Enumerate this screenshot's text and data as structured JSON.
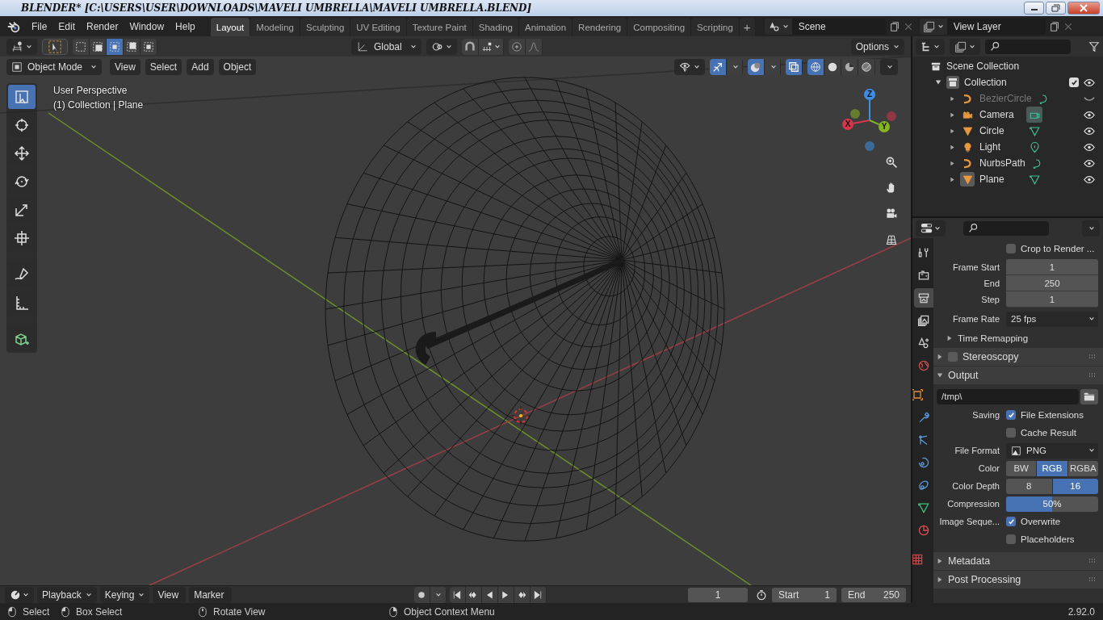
{
  "window": {
    "title": "BLENDER* [C:\\USERS\\USER\\DOWNLOADS\\MAVELI UMBRELLA\\MAVELI UMBRELLA.BLEND]"
  },
  "menu": [
    "File",
    "Edit",
    "Render",
    "Window",
    "Help"
  ],
  "workspaces": [
    {
      "label": "Layout",
      "selected": true
    },
    {
      "label": "Modeling",
      "selected": false
    },
    {
      "label": "Sculpting",
      "selected": false
    },
    {
      "label": "UV Editing",
      "selected": false
    },
    {
      "label": "Texture Paint",
      "selected": false
    },
    {
      "label": "Shading",
      "selected": false
    },
    {
      "label": "Animation",
      "selected": false
    },
    {
      "label": "Rendering",
      "selected": false
    },
    {
      "label": "Compositing",
      "selected": false
    },
    {
      "label": "Scripting",
      "selected": false
    }
  ],
  "add_workspace": "+",
  "scene": "Scene",
  "view_layer": "View Layer",
  "tool_settings": {
    "select_modes": [
      {
        "selected": false
      },
      {
        "selected": false
      },
      {
        "selected": true
      },
      {
        "selected": false
      },
      {
        "selected": false
      }
    ],
    "orientation": "Global",
    "options": "Options"
  },
  "viewport_header": {
    "mode": "Object Mode",
    "menus": [
      "View",
      "Select",
      "Add",
      "Object"
    ],
    "toggles": [
      {
        "kind": "gizmo",
        "on": true
      },
      {
        "kind": "overlays",
        "on": true
      },
      {
        "kind": "xray",
        "on": true
      }
    ],
    "shading": [
      {
        "kind": "wireframe",
        "selected": true
      },
      {
        "kind": "solid",
        "selected": false
      },
      {
        "kind": "material",
        "selected": false
      },
      {
        "kind": "rendered",
        "selected": false
      }
    ]
  },
  "viewport": {
    "perspective": "User Perspective",
    "context": "(1) Collection | Plane",
    "axes": [
      {
        "label": "X",
        "color": "#d8354a"
      },
      {
        "label": "Y",
        "color": "#84b525"
      },
      {
        "label": "Z",
        "color": "#3d8fe6"
      }
    ]
  },
  "tools": [
    {
      "kind": "select",
      "selected": true
    },
    {
      "kind": "cursor",
      "selected": false
    },
    {
      "kind": "move",
      "selected": false
    },
    {
      "kind": "rotate",
      "selected": false
    },
    {
      "kind": "scale",
      "selected": false
    },
    {
      "kind": "transform",
      "selected": false
    },
    {
      "kind": "annotate",
      "selected": false
    },
    {
      "kind": "measure",
      "selected": false
    },
    {
      "kind": "add_cube",
      "selected": false
    }
  ],
  "outliner": {
    "root": "Scene Collection",
    "collection": {
      "name": "Collection",
      "checked": true,
      "visible": true,
      "expanded": true,
      "children": [
        {
          "name": "BezierCircle",
          "kind": "curve",
          "visible": false,
          "selected": false
        },
        {
          "name": "Camera",
          "kind": "camera",
          "visible": true,
          "selected": false
        },
        {
          "name": "Circle",
          "kind": "mesh",
          "visible": true,
          "selected": false
        },
        {
          "name": "Light",
          "kind": "light",
          "visible": true,
          "selected": false
        },
        {
          "name": "NurbsPath",
          "kind": "curve",
          "visible": true,
          "selected": false
        },
        {
          "name": "Plane",
          "kind": "mesh",
          "visible": true,
          "selected": true
        }
      ]
    }
  },
  "properties": {
    "tabs": [
      {
        "kind": "tool",
        "selected": false
      },
      {
        "kind": "render",
        "selected": false
      },
      {
        "kind": "output",
        "selected": true
      },
      {
        "kind": "view_layer",
        "selected": false
      },
      {
        "kind": "scene",
        "selected": false
      },
      {
        "kind": "world",
        "selected": false
      },
      {
        "kind": "object",
        "selected": false
      },
      {
        "kind": "modifiers",
        "selected": false
      },
      {
        "kind": "particles",
        "selected": false
      },
      {
        "kind": "physics",
        "selected": false
      },
      {
        "kind": "constraints",
        "selected": false
      },
      {
        "kind": "data",
        "selected": false
      },
      {
        "kind": "material",
        "selected": false
      },
      {
        "kind": "texture",
        "selected": false
      }
    ],
    "crop": {
      "label": "Crop to Render ...",
      "checked": false
    },
    "frame_fields": [
      {
        "label": "Frame Start",
        "value": "1"
      },
      {
        "label": "End",
        "value": "250"
      },
      {
        "label": "Step",
        "value": "1"
      }
    ],
    "frame_rate": {
      "label": "Frame Rate",
      "value": "25 fps"
    },
    "time_remapping": {
      "label": "Time Remapping",
      "expanded": false
    },
    "stereoscopy": {
      "label": "Stereoscopy",
      "checked": false,
      "expanded": false
    },
    "output": {
      "label": "Output",
      "expanded": true,
      "path": "/tmp\\",
      "saving_label": "Saving",
      "saving": [
        {
          "label": "File Extensions",
          "checked": true
        },
        {
          "label": "Cache Result",
          "checked": false
        }
      ],
      "file_format": {
        "label": "File Format",
        "value": "PNG"
      },
      "color": {
        "label": "Color",
        "options": [
          {
            "label": "BW",
            "selected": false
          },
          {
            "label": "RGB",
            "selected": true
          },
          {
            "label": "RGBA",
            "selected": false
          }
        ]
      },
      "color_depth": {
        "label": "Color Depth",
        "options": [
          {
            "label": "8",
            "selected": false
          },
          {
            "label": "16",
            "selected": true
          }
        ]
      },
      "compression": {
        "label": "Compression",
        "value": "50%",
        "level": 0.5
      },
      "image_sequence_label": "Image Seque...",
      "image_sequence": [
        {
          "label": "Overwrite",
          "checked": true
        },
        {
          "label": "Placeholders",
          "checked": false
        }
      ]
    },
    "closed_panels": [
      {
        "label": "Metadata",
        "expanded": false
      },
      {
        "label": "Post Processing",
        "expanded": false
      }
    ]
  },
  "timeline": {
    "menus": [
      "Playback",
      "Keying",
      "View",
      "Marker"
    ],
    "current_frame": "1",
    "start_label": "Start",
    "start": "1",
    "end_label": "End",
    "end": "250"
  },
  "status_bar": {
    "hints": [
      {
        "kind": "left",
        "label": "Select"
      },
      {
        "kind": "drag",
        "label": "Box Select"
      },
      {
        "kind": "middle",
        "label": "Rotate View"
      },
      {
        "kind": "right",
        "label": "Object Context Menu"
      }
    ],
    "version": "2.92.0"
  }
}
